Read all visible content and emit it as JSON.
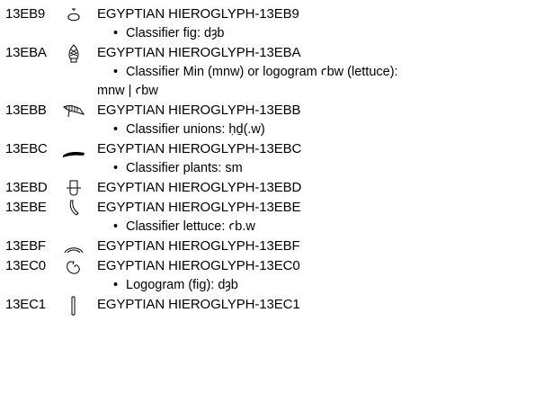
{
  "entries": [
    {
      "code": "13EB9",
      "glyph": "hieroglyph-13eb9-icon",
      "name": "EGYPTIAN HIEROGLYPH-13EB9",
      "notes": [
        "Classifier fig: dȝb"
      ]
    },
    {
      "code": "13EBA",
      "glyph": "hieroglyph-13eba-icon",
      "name": "EGYPTIAN HIEROGLYPH-13EBA",
      "notes": [
        "Classifier Min (mnw) or logogram ꜥbw (lettuce):"
      ],
      "continuation": "mnw | ꜥbw"
    },
    {
      "code": "13EBB",
      "glyph": "hieroglyph-13ebb-icon",
      "name": "EGYPTIAN HIEROGLYPH-13EBB",
      "notes": [
        "Classifier unions: ḥḏ(.w)"
      ]
    },
    {
      "code": "13EBC",
      "glyph": "hieroglyph-13ebc-icon",
      "name": "EGYPTIAN HIEROGLYPH-13EBC",
      "notes": [
        "Classifier plants: sm"
      ]
    },
    {
      "code": "13EBD",
      "glyph": "hieroglyph-13ebd-icon",
      "name": "EGYPTIAN HIEROGLYPH-13EBD",
      "notes": []
    },
    {
      "code": "13EBE",
      "glyph": "hieroglyph-13ebe-icon",
      "name": "EGYPTIAN HIEROGLYPH-13EBE",
      "notes": [
        "Classifier lettuce: ꜥb.w"
      ]
    },
    {
      "code": "13EBF",
      "glyph": "hieroglyph-13ebf-icon",
      "name": "EGYPTIAN HIEROGLYPH-13EBF",
      "notes": []
    },
    {
      "code": "13EC0",
      "glyph": "hieroglyph-13ec0-icon",
      "name": "EGYPTIAN HIEROGLYPH-13EC0",
      "notes": [
        "Logogram (fig): dȝb"
      ]
    },
    {
      "code": "13EC1",
      "glyph": "hieroglyph-13ec1-icon",
      "name": "EGYPTIAN HIEROGLYPH-13EC1",
      "notes": []
    }
  ]
}
